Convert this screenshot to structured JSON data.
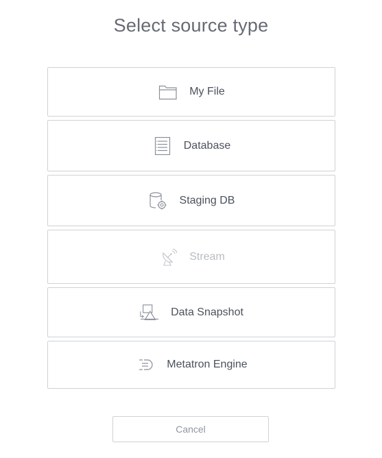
{
  "dialog": {
    "title": "Select source type"
  },
  "options": [
    {
      "label": "My File",
      "icon": "folder-icon",
      "enabled": true
    },
    {
      "label": "Database",
      "icon": "database-list-icon",
      "enabled": true
    },
    {
      "label": "Staging DB",
      "icon": "staging-db-icon",
      "enabled": true
    },
    {
      "label": "Stream",
      "icon": "satellite-dish-icon",
      "enabled": false
    },
    {
      "label": "Data Snapshot",
      "icon": "snapshot-shapes-icon",
      "enabled": true
    },
    {
      "label": "Metatron Engine",
      "icon": "engine-icon",
      "enabled": true
    }
  ],
  "footer": {
    "cancel_label": "Cancel"
  },
  "colors": {
    "border": "#d0d1d5",
    "text": "#4b515b",
    "title": "#666b73",
    "disabled": "#b9bcc2",
    "icon": "#8a8f98"
  }
}
